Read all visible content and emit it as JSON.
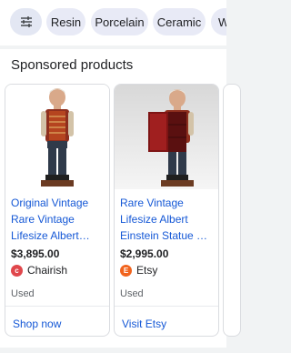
{
  "filters": {
    "chips": [
      "Resin",
      "Porcelain",
      "Ceramic",
      "W"
    ]
  },
  "sponsored": {
    "title": "Sponsored products",
    "cards": [
      {
        "title_lines": [
          "Original Vintage",
          "Rare Vintage",
          "Lifesize Albert…"
        ],
        "price": "$3,895.00",
        "seller": "Chairish",
        "seller_logo_color": "#e0474c",
        "seller_logo_glyph": "c",
        "condition": "Used",
        "action": "Shop now"
      },
      {
        "title_lines": [
          "Rare Vintage",
          "Lifesize Albert",
          "Einstein Statue …"
        ],
        "price": "$2,995.00",
        "seller": "Etsy",
        "seller_logo_color": "#f1641e",
        "seller_logo_glyph": "E",
        "condition": "Used",
        "action": "Visit Etsy"
      }
    ]
  },
  "colors": {
    "link": "#1558d6",
    "chip_bg": "#e8eaf6"
  }
}
